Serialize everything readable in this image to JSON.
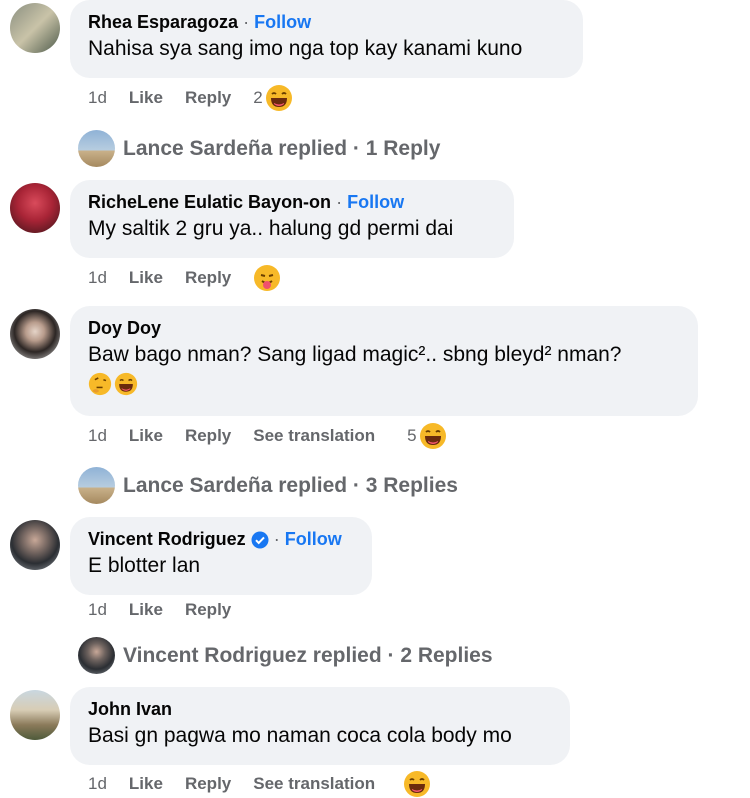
{
  "comments": [
    {
      "name": "Rhea Esparagoza",
      "follow": "Follow",
      "text": "Nahisa sya sang imo nga top kay kanami kuno",
      "time": "1d",
      "like": "Like",
      "reply": "Reply",
      "reaction_count": "2"
    },
    {
      "name": "RicheLene Eulatic Bayon-on",
      "follow": "Follow",
      "text": "My saltik 2 gru ya.. halung gd permi dai",
      "time": "1d",
      "like": "Like",
      "reply": "Reply"
    },
    {
      "name": "Doy Doy",
      "text": "Baw bago nman? Sang ligad magic².. sbng bleyd² nman?",
      "time": "1d",
      "like": "Like",
      "reply": "Reply",
      "see_translation": "See translation",
      "reaction_count": "5"
    },
    {
      "name": "Vincent Rodriguez",
      "follow": "Follow",
      "text": "E blotter lan",
      "time": "1d",
      "like": "Like",
      "reply": "Reply"
    },
    {
      "name": "John Ivan",
      "text": "Basi gn pagwa mo naman coca cola body mo",
      "time": "1d",
      "like": "Like",
      "reply": "Reply",
      "see_translation": "See translation"
    }
  ],
  "replies": [
    {
      "text": "Lance Sardeña replied · 1 Reply"
    },
    {
      "text": "Lance Sardeña replied · 3 Replies"
    },
    {
      "text": "Vincent Rodriguez replied · 2 Replies"
    }
  ],
  "separator": "·",
  "colors": {
    "bubble": "#f0f2f5",
    "follow": "#1877f2",
    "muted": "#65676b",
    "verified": "#1877f2"
  },
  "icons": [
    "laughing-emoji-icon",
    "tongue-emoji-icon",
    "thinking-emoji-icon",
    "verified-badge-icon"
  ]
}
